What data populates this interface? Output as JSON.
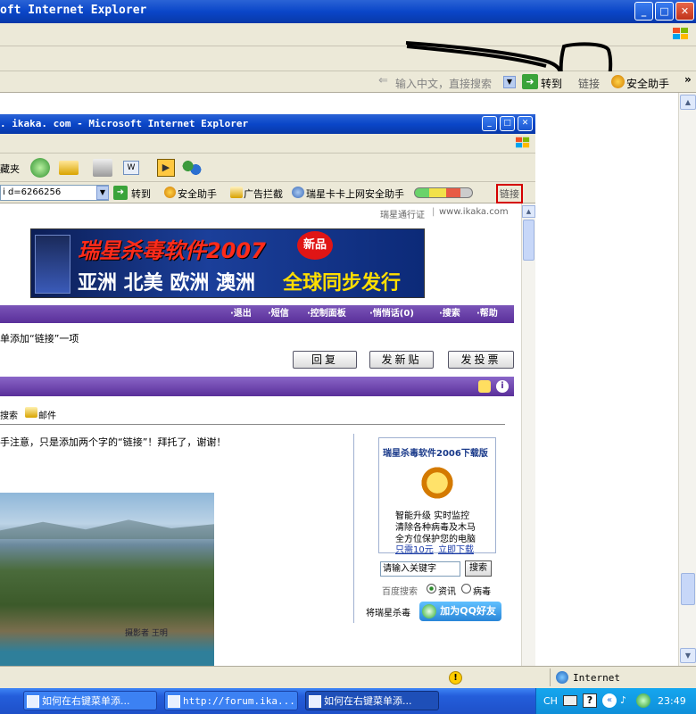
{
  "outer": {
    "title": "oft Internet Explorer",
    "window_buttons": [
      "_",
      "□",
      "✕"
    ],
    "search_placeholder": "输入中文，直接搜索",
    "goto": "转到",
    "links": "链接",
    "safety": "安全助手",
    "more": "»",
    "status": "Internet"
  },
  "inner": {
    "title": ". ikaka. com - Microsoft Internet Explorer",
    "favorites": "藏夹",
    "address": "i d=6266256",
    "goto": "转到",
    "safety": "安全助手",
    "adblock": "广告拦截",
    "rising_card": "瑞星卡卡上网安全助手",
    "links": "链接",
    "passport": "瑞星通行证",
    "site": "www.ikaka.com"
  },
  "banner": {
    "title": "瑞星杀毒软件2007",
    "badge": "新品",
    "regions": "亚洲 北美 欧洲 澳洲",
    "highlight": "全球同步发行"
  },
  "forum": {
    "nav_links": [
      "·退出",
      "·短信",
      "·控制面板",
      "·悄悄话(0)",
      "·搜索",
      "·帮助"
    ],
    "thread_title": "单添加“链接”一项",
    "btn_reply": "回复",
    "btn_new": "发新贴",
    "btn_poll": "发投票",
    "tool_search": "搜索",
    "tool_mail": "邮件",
    "post_text": "手注意，只是添加两个字的“链接”！拜托了，谢谢！",
    "watermark": "摄影者 王明"
  },
  "ad": {
    "title": "瑞星杀毒软件2006下载版",
    "line1": "智能升级 实时监控",
    "line2": "清除各种病毒及木马",
    "line3": "全方位保护您的电脑",
    "price": "只需10元",
    "download": "立即下载",
    "search_placeholder": "请输入关键字",
    "search_btn": "搜索",
    "search_label": "百度搜索",
    "opt_news": "资讯",
    "opt_virus": "病毒",
    "qq_label": "将瑞星杀毒",
    "qq_btn": "加为QQ好友"
  },
  "taskbar": {
    "items": [
      "如何在右键菜单添...",
      "http://forum.ika...",
      "如何在右键菜单添..."
    ],
    "lang": "CH",
    "clock": "23:49"
  },
  "colors": {
    "xp_blue": "#0a46c8",
    "purple": "#5a2f9a",
    "highlight_red": "#d40000"
  }
}
